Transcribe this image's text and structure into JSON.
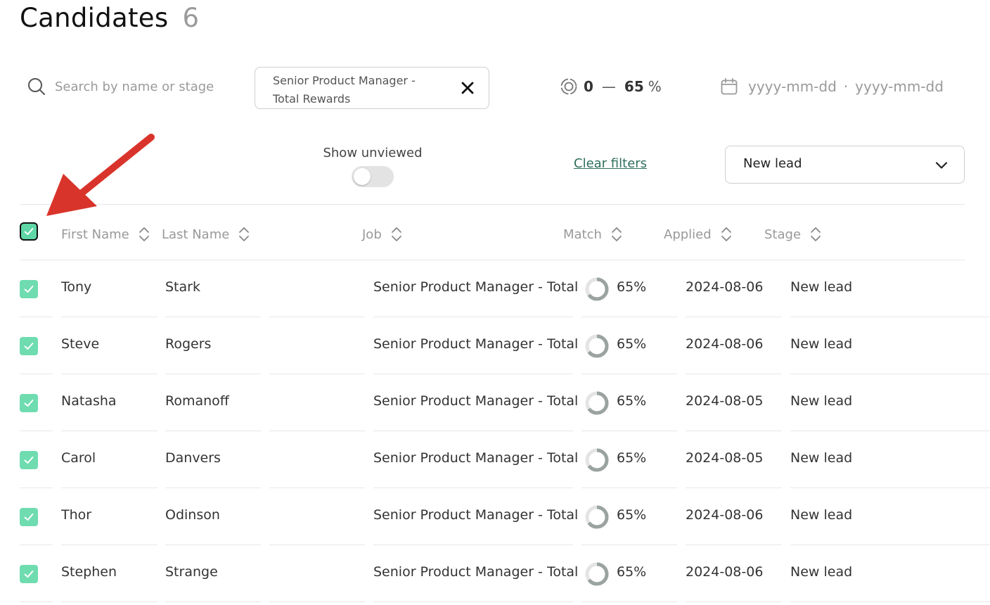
{
  "page": {
    "title": "Candidates",
    "count": "6"
  },
  "filters": {
    "search_placeholder": "Search by name or stage",
    "job_chip_line1": "Senior Product Manager -",
    "job_chip_line2": "Total Rewards",
    "match_min": "0",
    "match_dash": "—",
    "match_max": "65",
    "match_unit": "%",
    "date_from": "yyyy-mm-dd",
    "date_separator": "·",
    "date_to": "yyyy-mm-dd",
    "show_unviewed_label": "Show unviewed",
    "show_unviewed_on": false,
    "clear_filters_label": "Clear filters",
    "stage_selected": "New lead"
  },
  "table": {
    "columns": {
      "first_name": "First Name",
      "last_name": "Last Name",
      "job": "Job",
      "match": "Match",
      "applied": "Applied",
      "stage": "Stage"
    },
    "rows": [
      {
        "first": "Tony",
        "last": "Stark",
        "job": "Senior Product Manager - Total",
        "match": "65%",
        "applied": "2024-08-06",
        "stage": "New lead",
        "checked": true
      },
      {
        "first": "Steve",
        "last": "Rogers",
        "job": "Senior Product Manager - Total",
        "match": "65%",
        "applied": "2024-08-06",
        "stage": "New lead",
        "checked": true
      },
      {
        "first": "Natasha",
        "last": "Romanoff",
        "job": "Senior Product Manager - Total",
        "match": "65%",
        "applied": "2024-08-05",
        "stage": "New lead",
        "checked": true
      },
      {
        "first": "Carol",
        "last": "Danvers",
        "job": "Senior Product Manager - Total",
        "match": "65%",
        "applied": "2024-08-05",
        "stage": "New lead",
        "checked": true
      },
      {
        "first": "Thor",
        "last": "Odinson",
        "job": "Senior Product Manager - Total",
        "match": "65%",
        "applied": "2024-08-06",
        "stage": "New lead",
        "checked": true
      },
      {
        "first": "Stephen",
        "last": "Strange",
        "job": "Senior Product Manager - Total",
        "match": "65%",
        "applied": "2024-08-06",
        "stage": "New lead",
        "checked": true
      }
    ]
  },
  "colors": {
    "accent_green": "#6fdcb0",
    "link_green": "#2f6f5c",
    "annotation_arrow": "#d9342b"
  },
  "icons": {
    "search": "search-icon",
    "close": "close-icon",
    "match": "target-icon",
    "date": "calendar-icon",
    "dropdown": "chevron-down-icon",
    "sort": "sort-icon",
    "checkbox": "checkmark-icon",
    "annotation": "arrow-icon"
  }
}
